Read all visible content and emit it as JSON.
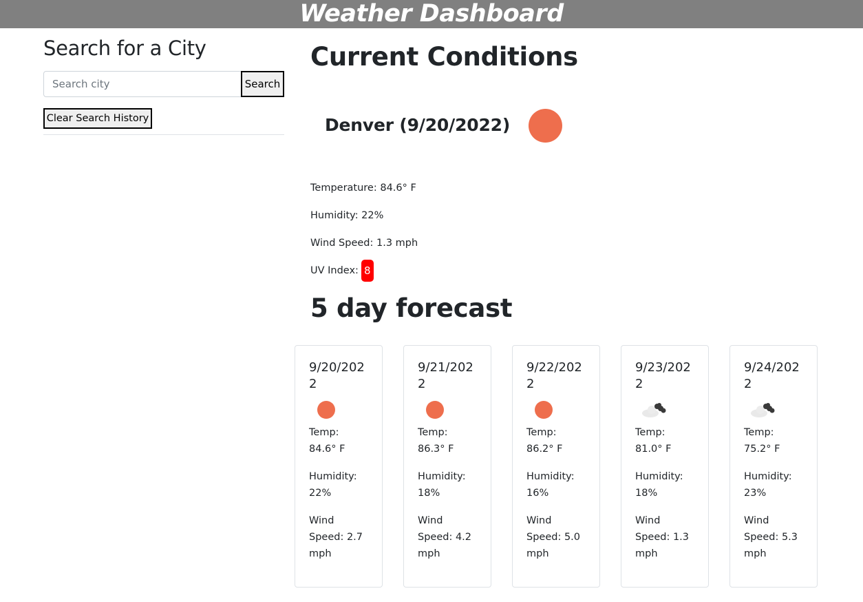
{
  "header": {
    "title": "Weather Dashboard"
  },
  "sidebar": {
    "heading": "Search for a City",
    "search_placeholder": "Search city",
    "search_value": "",
    "search_button": "Search",
    "clear_button": "Clear Search History"
  },
  "current": {
    "heading": "Current Conditions",
    "city_date": "Denver (9/20/2022)",
    "icon": "sun-icon",
    "temperature": "Temperature: 84.6° F",
    "humidity": "Humidity: 22%",
    "wind": "Wind Speed: 1.3 mph",
    "uv_label": "UV Index:",
    "uv_value": "8",
    "uv_color": "#ff0000"
  },
  "forecast": {
    "heading": "5 day forecast",
    "days": [
      {
        "date": "9/20/2022",
        "icon": "sun-icon",
        "temp": "Temp: 84.6° F",
        "humidity": "Humidity: 22%",
        "wind": "Wind Speed: 2.7 mph"
      },
      {
        "date": "9/21/2022",
        "icon": "sun-icon",
        "temp": "Temp: 86.3° F",
        "humidity": "Humidity: 18%",
        "wind": "Wind Speed: 4.2 mph"
      },
      {
        "date": "9/22/2022",
        "icon": "sun-icon",
        "temp": "Temp: 86.2° F",
        "humidity": "Humidity: 16%",
        "wind": "Wind Speed: 5.0 mph"
      },
      {
        "date": "9/23/2022",
        "icon": "cloud-icon",
        "temp": "Temp: 81.0° F",
        "humidity": "Humidity: 18%",
        "wind": "Wind Speed: 1.3 mph"
      },
      {
        "date": "9/24/2022",
        "icon": "cloud-icon",
        "temp": "Temp: 75.2° F",
        "humidity": "Humidity: 23%",
        "wind": "Wind Speed: 5.3 mph"
      }
    ]
  },
  "colors": {
    "header_bg": "#808080",
    "sun": "#ee6e4d",
    "uv_badge": "#ff0000"
  }
}
